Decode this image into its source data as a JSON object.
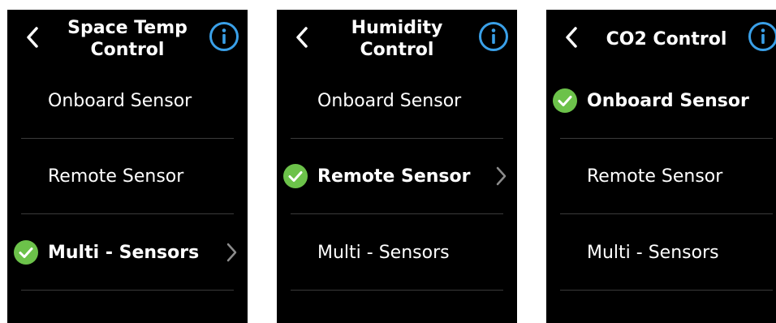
{
  "accent_colors": {
    "info": "#3aa0e8",
    "check": "#6cc24a",
    "chevron": "#8c8c8c"
  },
  "panels": [
    {
      "title_line1": "Space Temp",
      "title_line2": "Control",
      "options": [
        {
          "label": "Onboard Sensor",
          "selected": false
        },
        {
          "label": "Remote Sensor",
          "selected": false
        },
        {
          "label": "Multi - Sensors",
          "selected": true
        }
      ]
    },
    {
      "title_line1": "Humidity",
      "title_line2": "Control",
      "options": [
        {
          "label": "Onboard Sensor",
          "selected": false
        },
        {
          "label": "Remote Sensor",
          "selected": true
        },
        {
          "label": "Multi - Sensors",
          "selected": false
        }
      ]
    },
    {
      "title_line1": "CO2 Control",
      "title_line2": "",
      "options": [
        {
          "label": "Onboard Sensor",
          "selected": true
        },
        {
          "label": "Remote Sensor",
          "selected": false
        },
        {
          "label": "Multi - Sensors",
          "selected": false
        }
      ]
    }
  ]
}
